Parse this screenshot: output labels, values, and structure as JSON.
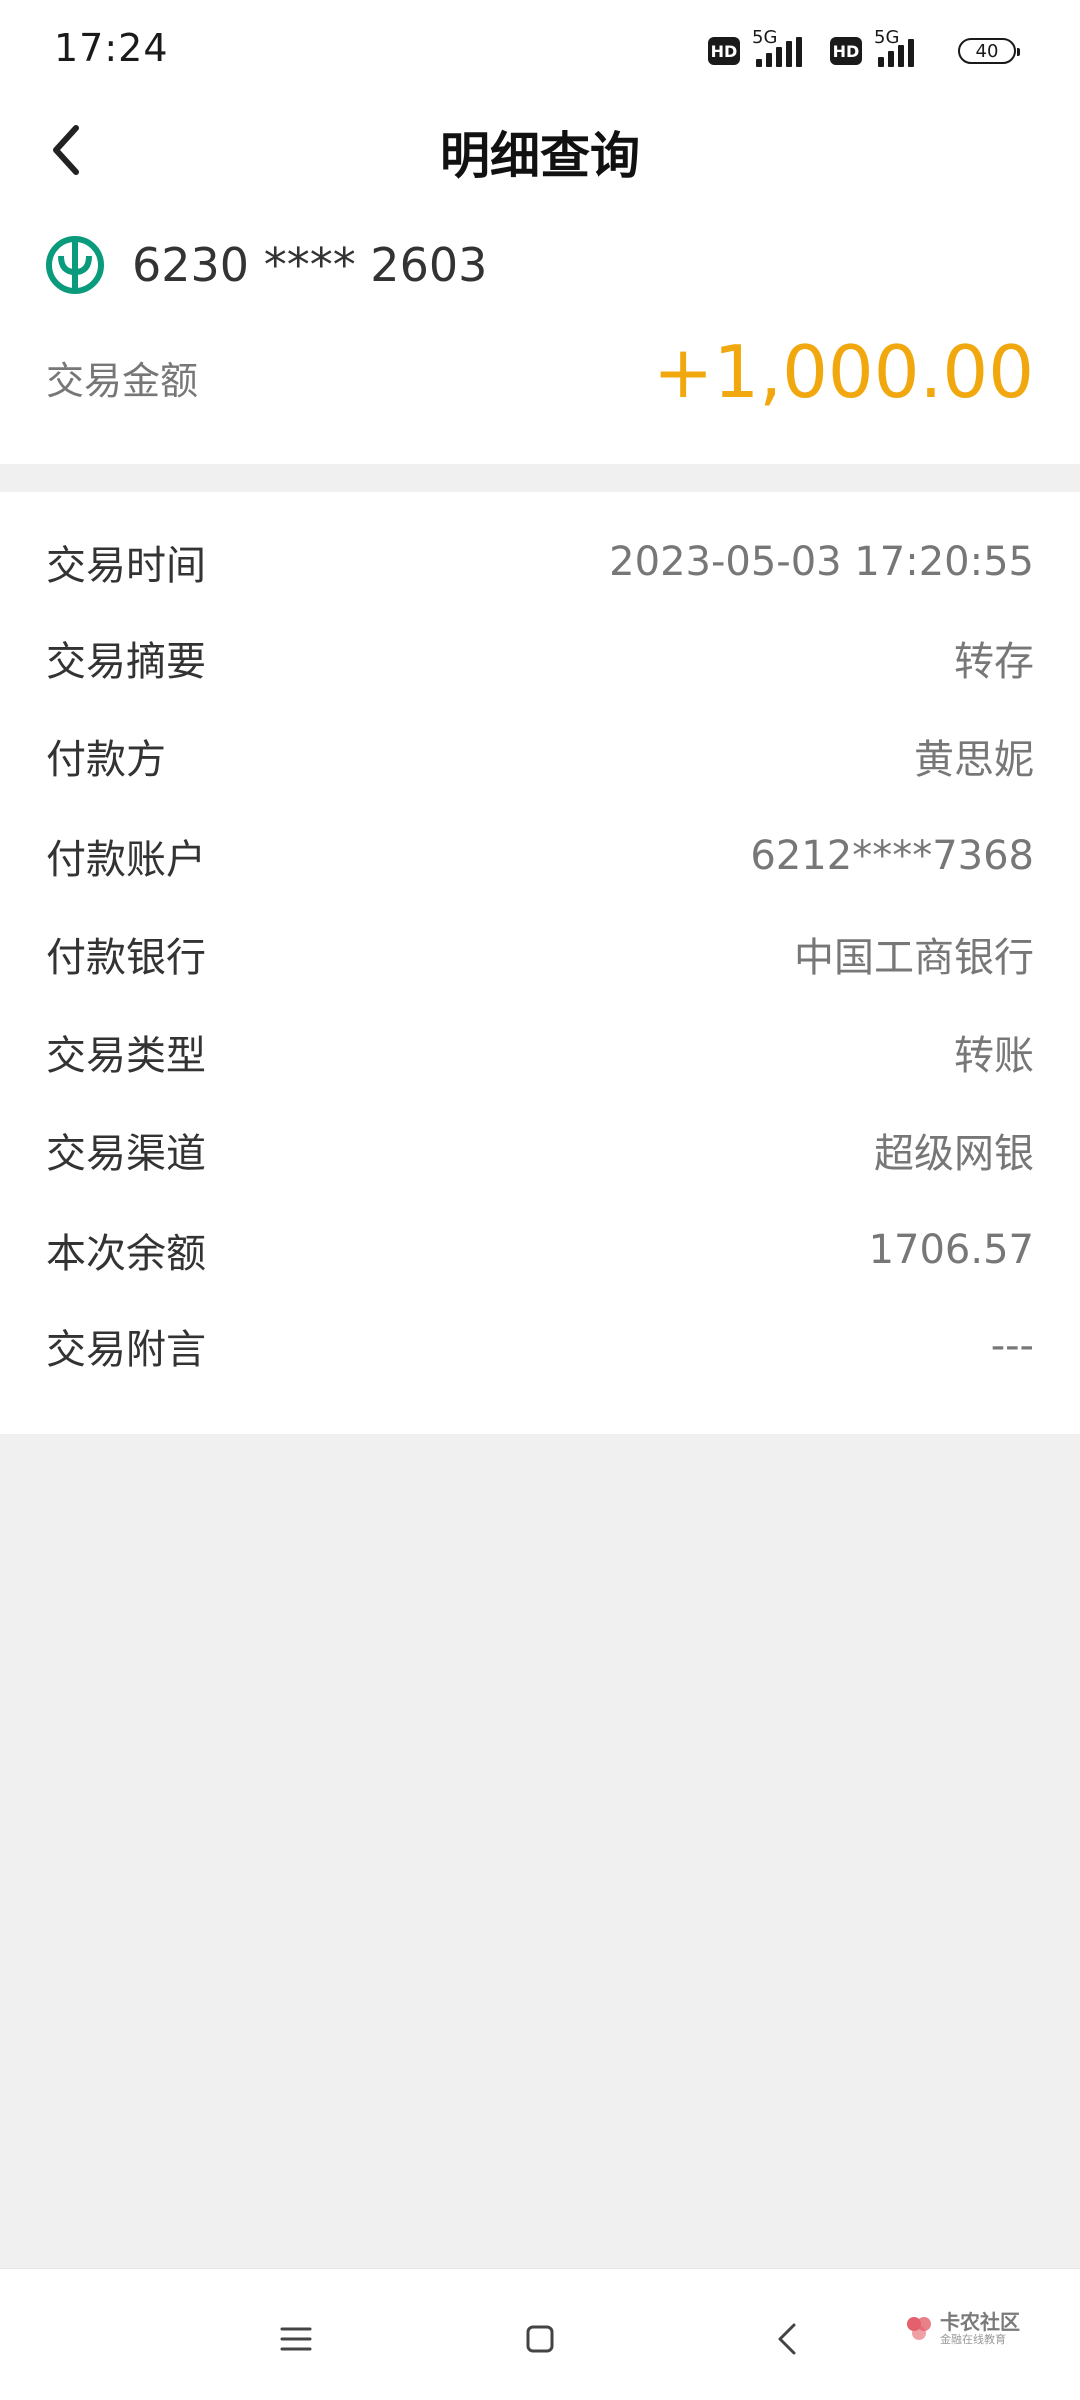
{
  "status_bar": {
    "time": "17:24",
    "hd_label": "HD",
    "network_label": "5G",
    "battery": "40"
  },
  "header": {
    "title": "明细查询"
  },
  "account": {
    "card_number": "6230 **** 2603",
    "amount_label": "交易金额",
    "amount_value": "+1,000.00",
    "amount_color": "#f1a80f",
    "bank_logo_color": "#0a9a7c"
  },
  "details": [
    {
      "label": "交易时间",
      "value": "2023-05-03 17:20:55"
    },
    {
      "label": "交易摘要",
      "value": "转存"
    },
    {
      "label": "付款方",
      "value": "黄思妮"
    },
    {
      "label": "付款账户",
      "value": "6212****7368"
    },
    {
      "label": "付款银行",
      "value": "中国工商银行"
    },
    {
      "label": "交易类型",
      "value": "转账"
    },
    {
      "label": "交易渠道",
      "value": "超级网银"
    },
    {
      "label": "本次余额",
      "value": "1706.57"
    },
    {
      "label": "交易附言",
      "value": "---"
    }
  ],
  "nav_bar": {
    "icons": [
      "menu-icon",
      "home-icon",
      "back-icon"
    ]
  },
  "watermark": {
    "main": "卡农社区",
    "sub": "金融在线教育"
  }
}
